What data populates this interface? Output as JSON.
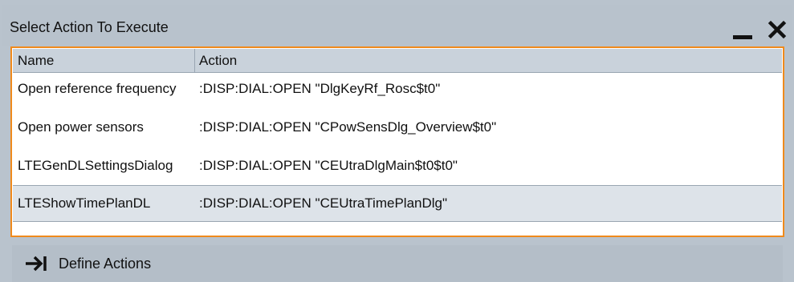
{
  "window": {
    "title": "Select Action To Execute"
  },
  "table": {
    "columns": [
      "Name",
      "Action"
    ],
    "rows": [
      {
        "name": "Open reference frequency",
        "action": ":DISP:DIAL:OPEN \"DlgKeyRf_Rosc$t0\""
      },
      {
        "name": "Open power sensors",
        "action": ":DISP:DIAL:OPEN \"CPowSensDlg_Overview$t0\""
      },
      {
        "name": "LTEGenDLSettingsDialog",
        "action": ":DISP:DIAL:OPEN \"CEUtraDlgMain$t0$t0\""
      },
      {
        "name": "LTEShowTimePlanDL",
        "action": ":DISP:DIAL:OPEN \"CEUtraTimePlanDlg\""
      }
    ],
    "selected_row": "LTEShowTimePlanDL"
  },
  "footer": {
    "define_actions_label": "Define Actions",
    "define_actions_icon": "arrow-to-bar-icon"
  },
  "colors": {
    "frame_border": "#f08a1c",
    "titlebar": "#b8c2cc",
    "header": "#c9d2db",
    "selected_row": "#dde3e9"
  }
}
